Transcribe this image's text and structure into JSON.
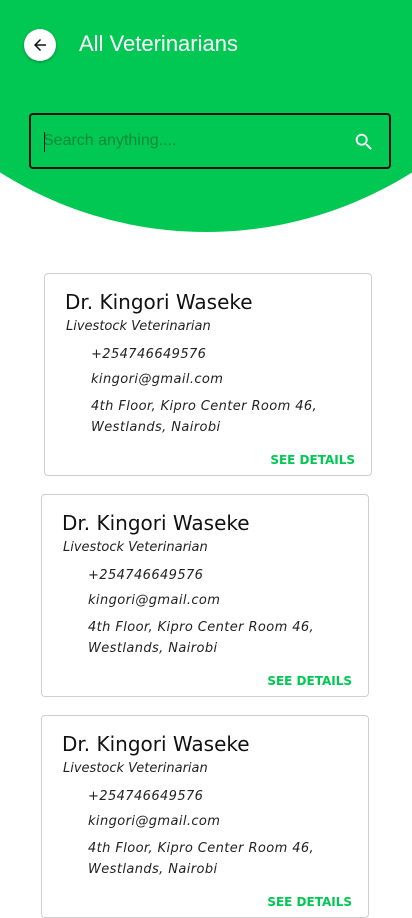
{
  "header": {
    "title": "All Veterinarians",
    "back_icon": "arrow-left-icon",
    "color": "#00C853"
  },
  "search": {
    "placeholder": "Search anything....",
    "value": "",
    "icon": "search-icon"
  },
  "vets": [
    {
      "name": "Dr. Kingori Waseke",
      "role": "Livestock Veterinarian",
      "phone": "+254746649576",
      "email": "kingori@gmail.com",
      "address": "4th Floor, Kipro Center Room 46, Westlands, Nairobi",
      "action": "SEE DETAILS"
    },
    {
      "name": "Dr. Kingori Waseke",
      "role": "Livestock Veterinarian",
      "phone": "+254746649576",
      "email": "kingori@gmail.com",
      "address": "4th Floor, Kipro Center Room 46, Westlands, Nairobi",
      "action": "SEE DETAILS"
    },
    {
      "name": "Dr. Kingori Waseke",
      "role": "Livestock Veterinarian",
      "phone": "+254746649576",
      "email": "kingori@gmail.com",
      "address": "4th Floor, Kipro Center Room 46, Westlands, Nairobi",
      "action": "SEE DETAILS"
    }
  ]
}
